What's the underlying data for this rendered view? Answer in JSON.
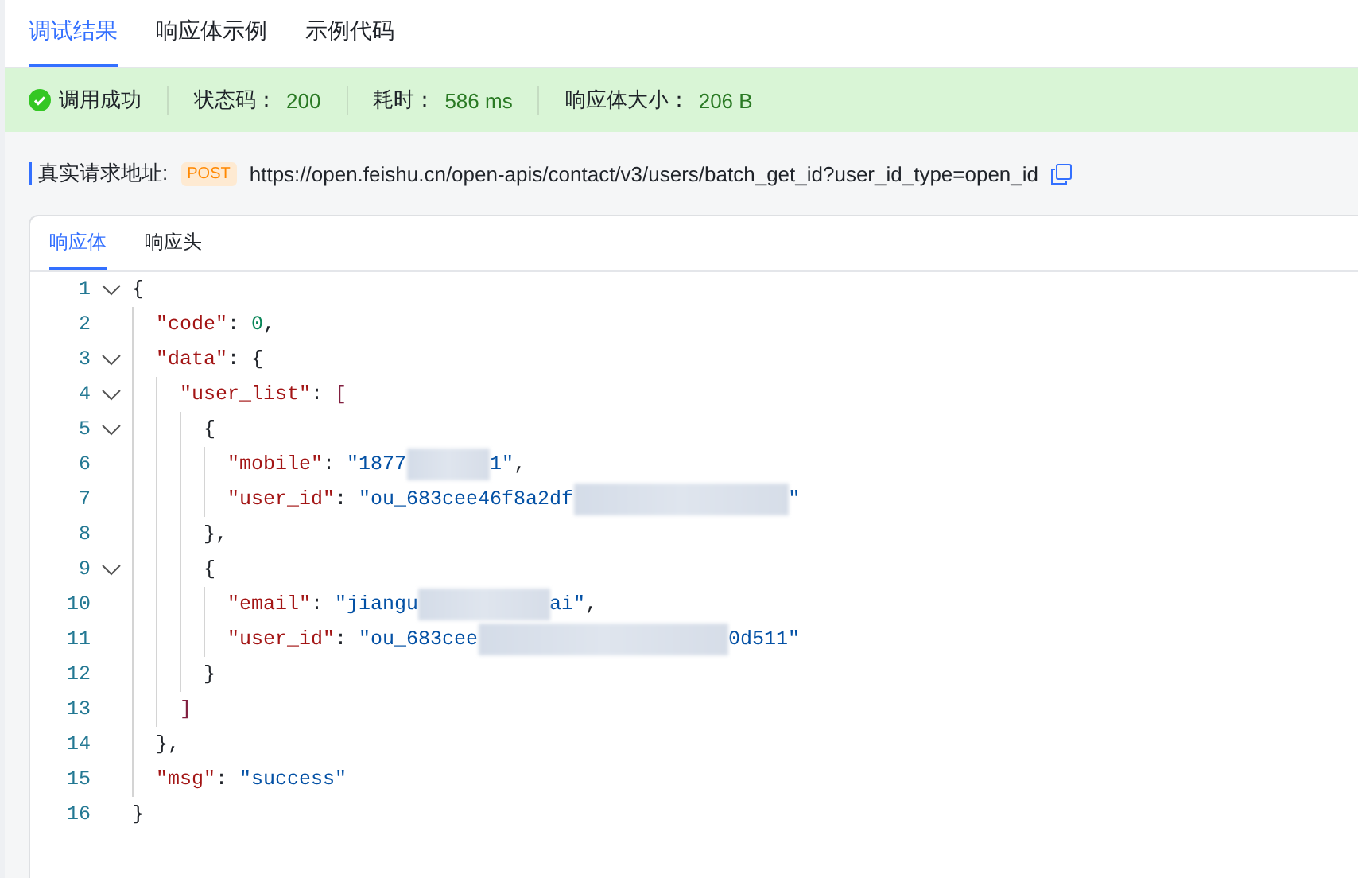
{
  "tabs": [
    {
      "label": "调试结果",
      "selected": true
    },
    {
      "label": "响应体示例",
      "selected": false
    },
    {
      "label": "示例代码",
      "selected": false
    }
  ],
  "result": {
    "status": "调用成功",
    "success": true,
    "items": [
      {
        "label": "状态码：",
        "value": "200"
      },
      {
        "label": "耗时：",
        "value": "586 ms"
      },
      {
        "label": "响应体大小：",
        "value": "206 B"
      }
    ]
  },
  "request": {
    "label": "真实请求地址:",
    "method": "POST",
    "url": "https://open.feishu.cn/open-apis/contact/v3/users/batch_get_id?user_id_type=open_id"
  },
  "response_tabs": [
    {
      "label": "响应体",
      "selected": true
    },
    {
      "label": "响应头",
      "selected": false
    }
  ],
  "code_lines": [
    {
      "number": "1",
      "foldable": true,
      "tokens": [
        {
          "kind": "punct",
          "text": "{"
        }
      ],
      "children": [
        {
          "number": "2",
          "foldable": false,
          "tokens": [
            {
              "kind": "key",
              "text": "\"code\""
            },
            {
              "kind": "punct",
              "text": ": "
            },
            {
              "kind": "number",
              "text": "0"
            },
            {
              "kind": "punct",
              "text": ","
            }
          ]
        },
        {
          "number": "3",
          "foldable": true,
          "tokens": [
            {
              "kind": "key",
              "text": "\"data\""
            },
            {
              "kind": "punct",
              "text": ": {"
            }
          ],
          "children": [
            {
              "number": "4",
              "foldable": true,
              "tokens": [
                {
                  "kind": "key",
                  "text": "\"user_list\""
                },
                {
                  "kind": "punct",
                  "text": ": "
                },
                {
                  "kind": "bracket",
                  "text": "["
                }
              ],
              "children": [
                {
                  "number": "5",
                  "foldable": true,
                  "tokens": [
                    {
                      "kind": "punct",
                      "text": "{"
                    }
                  ],
                  "children": [
                    {
                      "number": "6",
                      "foldable": false,
                      "tokens": [
                        {
                          "kind": "key",
                          "text": "\"mobile\""
                        },
                        {
                          "kind": "punct",
                          "text": ": "
                        },
                        {
                          "kind": "string",
                          "text": "\"1877"
                        },
                        {
                          "kind": "redacted"
                        },
                        {
                          "kind": "string",
                          "text": "1\""
                        },
                        {
                          "kind": "punct",
                          "text": ","
                        }
                      ]
                    },
                    {
                      "number": "7",
                      "foldable": false,
                      "tokens": [
                        {
                          "kind": "key",
                          "text": "\"user_id\""
                        },
                        {
                          "kind": "punct",
                          "text": ": "
                        },
                        {
                          "kind": "string",
                          "text": "\"ou_683cee46f8a2df"
                        },
                        {
                          "kind": "redacted"
                        },
                        {
                          "kind": "string",
                          "text": "\""
                        }
                      ]
                    }
                  ]
                },
                {
                  "number": "8",
                  "foldable": false,
                  "tokens": [
                    {
                      "kind": "punct",
                      "text": "},"
                    }
                  ]
                },
                {
                  "number": "9",
                  "foldable": true,
                  "tokens": [
                    {
                      "kind": "punct",
                      "text": "{"
                    }
                  ],
                  "children": [
                    {
                      "number": "10",
                      "foldable": false,
                      "tokens": [
                        {
                          "kind": "key",
                          "text": "\"email\""
                        },
                        {
                          "kind": "punct",
                          "text": ": "
                        },
                        {
                          "kind": "string",
                          "text": "\"jiangu"
                        },
                        {
                          "kind": "redacted"
                        },
                        {
                          "kind": "string",
                          "text": "ai\""
                        },
                        {
                          "kind": "punct",
                          "text": ","
                        }
                      ]
                    },
                    {
                      "number": "11",
                      "foldable": false,
                      "tokens": [
                        {
                          "kind": "key",
                          "text": "\"user_id\""
                        },
                        {
                          "kind": "punct",
                          "text": ": "
                        },
                        {
                          "kind": "string",
                          "text": "\"ou_683cee"
                        },
                        {
                          "kind": "redacted"
                        },
                        {
                          "kind": "string",
                          "text": "0d511\""
                        }
                      ]
                    }
                  ]
                },
                {
                  "number": "12",
                  "foldable": false,
                  "tokens": [
                    {
                      "kind": "punct",
                      "text": "}"
                    }
                  ]
                }
              ]
            },
            {
              "number": "13",
              "foldable": false,
              "tokens": [
                {
                  "kind": "bracket",
                  "text": "]"
                }
              ]
            }
          ]
        },
        {
          "number": "14",
          "foldable": false,
          "tokens": [
            {
              "kind": "punct",
              "text": "},"
            }
          ]
        },
        {
          "number": "15",
          "foldable": false,
          "tokens": [
            {
              "kind": "key",
              "text": "\"msg\""
            },
            {
              "kind": "punct",
              "text": ": "
            },
            {
              "kind": "string",
              "text": "\"success\""
            }
          ]
        }
      ]
    },
    {
      "number": "16",
      "foldable": false,
      "tokens": [
        {
          "kind": "punct",
          "text": "}"
        }
      ]
    }
  ]
}
